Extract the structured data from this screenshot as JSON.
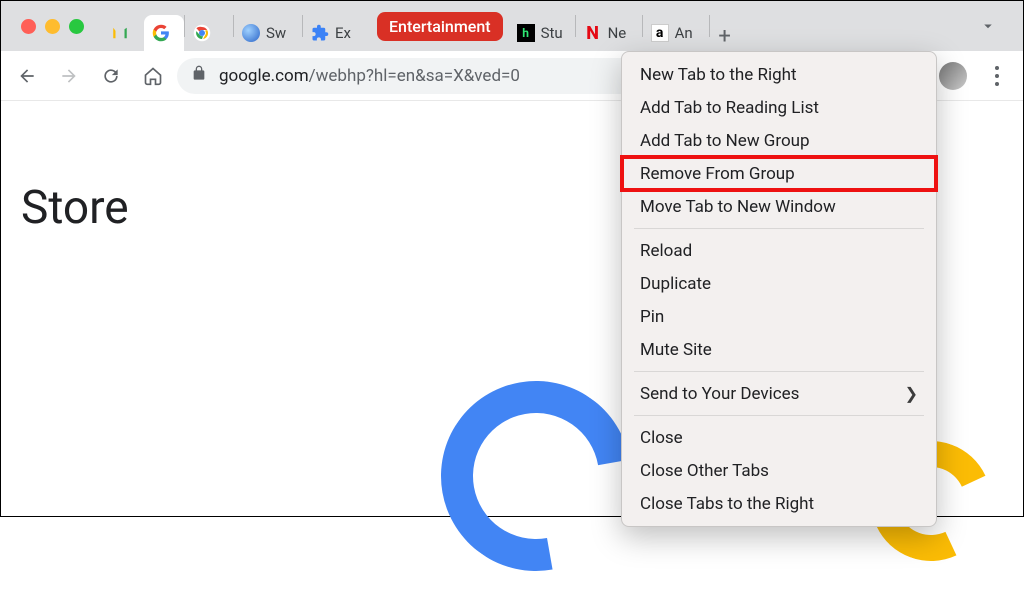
{
  "tabs": {
    "group_label": "Entertainment",
    "t2_label": "Sw",
    "t3_label": "Ex",
    "t4_label": "Stu",
    "t5_label": "Ne",
    "t6_label": "An"
  },
  "omnibox": {
    "host": "google.com",
    "path": "/webhp?hl=en&sa=X&ved=0"
  },
  "page": {
    "store_label": "Store"
  },
  "context_menu": {
    "items": [
      "New Tab to the Right",
      "Add Tab to Reading List",
      "Add Tab to New Group",
      "Remove From Group",
      "Move Tab to New Window"
    ],
    "items2": [
      "Reload",
      "Duplicate",
      "Pin",
      "Mute Site"
    ],
    "items3_label": "Send to Your Devices",
    "items4": [
      "Close",
      "Close Other Tabs",
      "Close Tabs to the Right"
    ],
    "highlighted_index": 3
  }
}
